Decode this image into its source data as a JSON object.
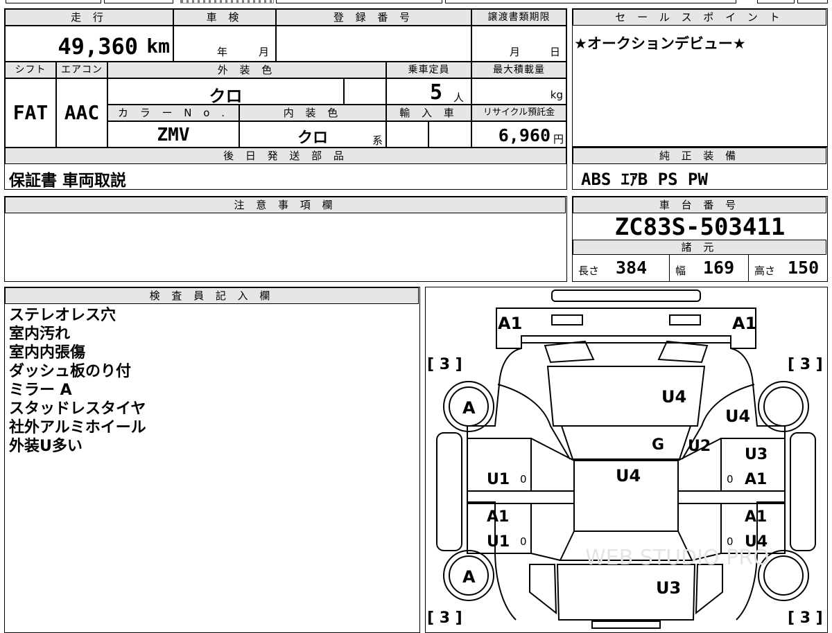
{
  "top_info": {
    "mileage_header": "走 行",
    "mileage_value": "49,360",
    "mileage_unit": "km",
    "inspection_header": "車 検",
    "inspection_year_unit": "年",
    "inspection_month_unit": "月",
    "registration_header": "登 録 番 号",
    "transfer_header": "譲渡書類期限",
    "transfer_month_unit": "月",
    "transfer_day_unit": "日",
    "shift_header": "シフト",
    "shift_value": "FAT",
    "ac_header": "エアコン",
    "ac_value": "AAC",
    "exterior_header": "外 装 色",
    "exterior_value": "クロ",
    "capacity_header": "乗車定員",
    "capacity_value": "5",
    "capacity_unit": "人",
    "max_load_header": "最大積載量",
    "max_load_unit": "kg",
    "color_no_header": "カ ラ ー N o .",
    "color_no_value": "ZMV",
    "interior_header": "内 装 色",
    "interior_value": "クロ",
    "interior_suffix": "系",
    "import_header": "輸 入 車",
    "recycle_header": "リサイクル預託金",
    "recycle_value": "6,960",
    "recycle_unit": "円",
    "later_parts_header": "後 日 発 送 部 品",
    "later_parts_value": "保証書 車両取説"
  },
  "sales_point": {
    "header": "セ ー ル ス ポ イ ン ト",
    "text": "★オークションデビュー★"
  },
  "genuine_equipment": {
    "header": "純 正 装 備",
    "value": "ABS ｴｱB PS PW"
  },
  "notes": {
    "header": "注 意 事 項 欄",
    "value": ""
  },
  "chassis": {
    "header": "車 台 番 号",
    "value": "ZC83S-503411",
    "spec_header": "諸 元",
    "length_label": "長さ",
    "length_value": "384",
    "width_label": "幅",
    "width_value": "169",
    "height_label": "高さ",
    "height_value": "150"
  },
  "inspector": {
    "header": "検 査 員 記 入 欄",
    "items": [
      "ステレオレス穴",
      "室内汚れ",
      "室内内張傷",
      "ダッシュ板のり付",
      "ミラー A",
      "スタッドレスタイヤ",
      "社外アルミホイール",
      "外装U多い"
    ]
  },
  "diagram": {
    "tire_tread_fl": "[ 3 ]",
    "tire_tread_fr": "[ 3 ]",
    "tire_tread_rl": "[ 3 ]",
    "tire_tread_rr": "[ 3 ]",
    "wheel_front_left": "A",
    "wheel_rear_left": "A",
    "marks": {
      "front_bumper_left": "A1",
      "front_bumper_right": "A1",
      "hood": "U4",
      "right_front_fender": "U4",
      "windshield": "G",
      "right_pillar": "U2",
      "right_front_door_top": "U3",
      "right_front_door": "A1",
      "roof": "U4",
      "left_front_door": "U1",
      "left_rear_door_top": "A1",
      "left_rear_door": "U1",
      "right_rear_door_top": "A1",
      "right_rear_door": "U4",
      "rear": "U3",
      "lf_zero": "0",
      "lr_zero": "0",
      "rf_zero": "0",
      "rr_zero": "0"
    },
    "watermark": "WEB STUDIO PRO"
  }
}
